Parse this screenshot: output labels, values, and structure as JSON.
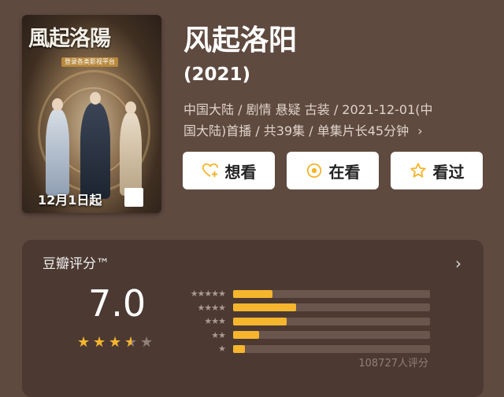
{
  "poster": {
    "calligraphy": "風起洛陽",
    "badge": "登录各类影视平台",
    "date_text": "12月1日起"
  },
  "title": "风起洛阳",
  "year": "(2021)",
  "meta_line1": "中国大陆 / 剧情 悬疑 古装 / 2021-12-01(中",
  "meta_line2": "国大陆)首播 / 共39集 / 单集片长45分钟",
  "meta_chevron": "›",
  "buttons": [
    {
      "label": "想看",
      "icon": "heart-plus-icon"
    },
    {
      "label": "在看",
      "icon": "dot-circle-icon"
    },
    {
      "label": "看过",
      "icon": "star-outline-icon"
    }
  ],
  "colors": {
    "accent": "#f5b52d",
    "background": "#5f4a40",
    "card": "#4c3a32"
  },
  "rating": {
    "label": "豆瓣评分™",
    "score": "7.0",
    "stars_value": 3.5,
    "count_text": "108727人评分",
    "distribution": [
      {
        "stars": "★★★★★",
        "fraction": 0.2
      },
      {
        "stars": "★★★★",
        "fraction": 0.32
      },
      {
        "stars": "★★★",
        "fraction": 0.27
      },
      {
        "stars": "★★",
        "fraction": 0.13
      },
      {
        "stars": "★",
        "fraction": 0.06
      }
    ]
  }
}
